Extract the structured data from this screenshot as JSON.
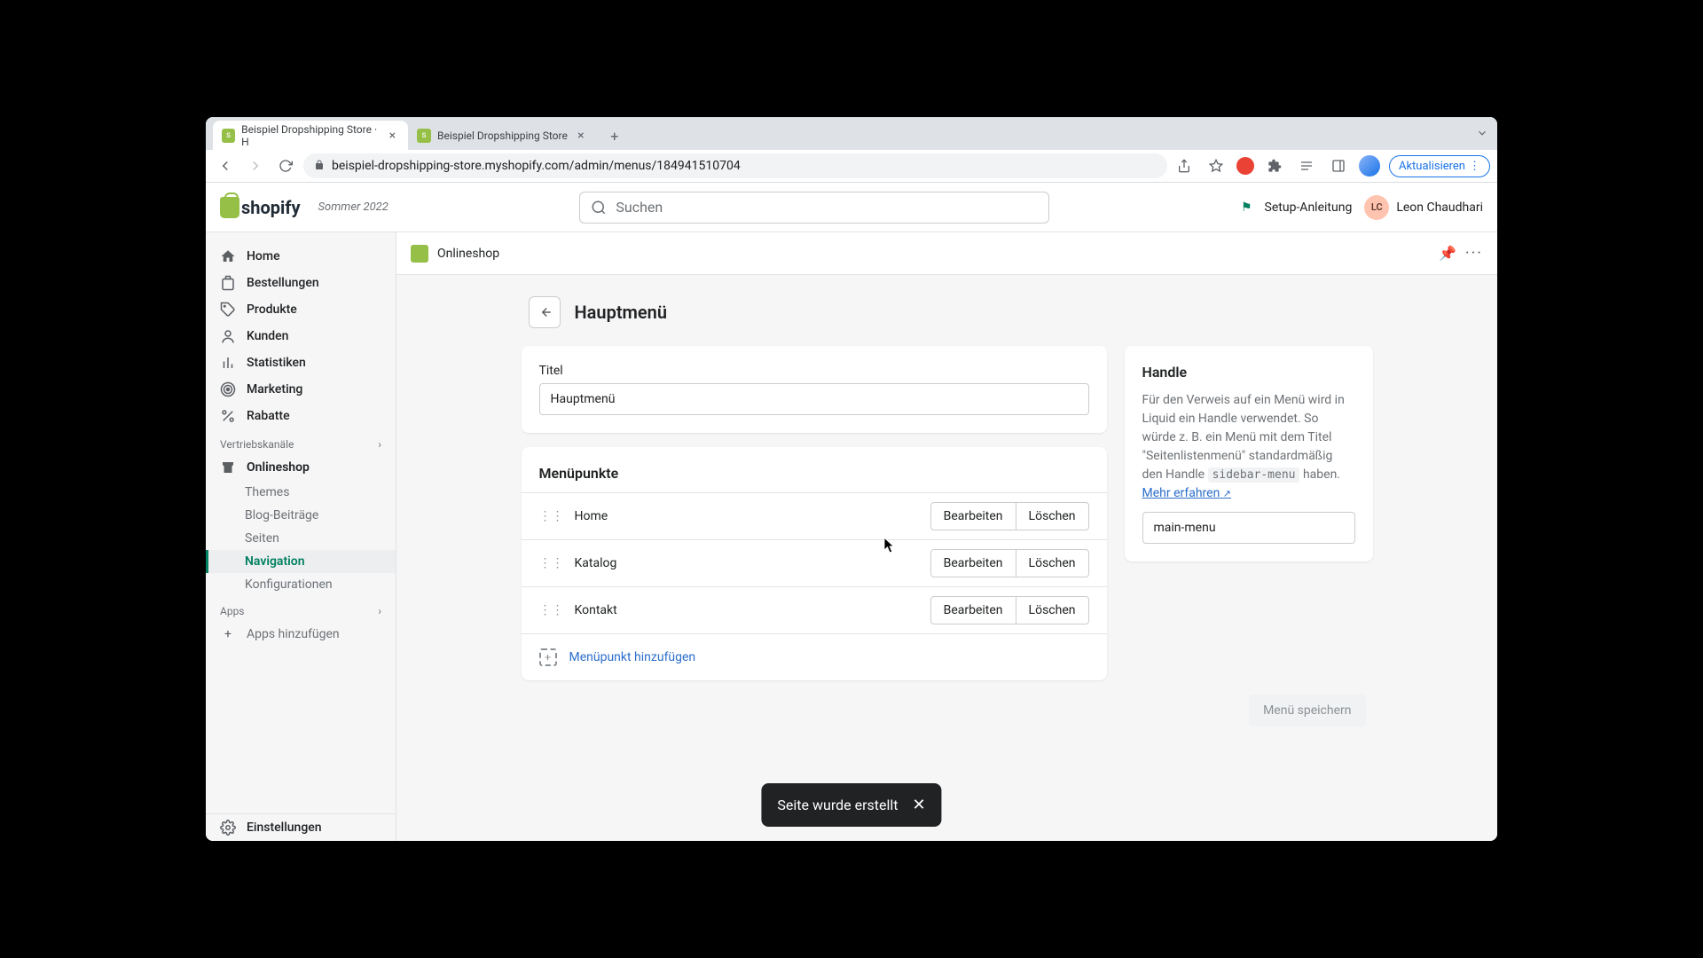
{
  "browser": {
    "tabs": [
      {
        "label": "Beispiel Dropshipping Store · H",
        "active": true
      },
      {
        "label": "Beispiel Dropshipping Store",
        "active": false
      }
    ],
    "url": "beispiel-dropshipping-store.myshopify.com/admin/menus/184941510704",
    "update_label": "Aktualisieren"
  },
  "header": {
    "brand": "shopify",
    "season": "Sommer 2022",
    "search_placeholder": "Suchen",
    "setup_label": "Setup-Anleitung",
    "user_initials": "LC",
    "user_name": "Leon Chaudhari"
  },
  "sidebar": {
    "items": [
      {
        "label": "Home"
      },
      {
        "label": "Bestellungen"
      },
      {
        "label": "Produkte"
      },
      {
        "label": "Kunden"
      },
      {
        "label": "Statistiken"
      },
      {
        "label": "Marketing"
      },
      {
        "label": "Rabatte"
      }
    ],
    "channels_label": "Vertriebskanäle",
    "onlineshop": "Onlineshop",
    "sub": [
      {
        "label": "Themes"
      },
      {
        "label": "Blog-Beiträge"
      },
      {
        "label": "Seiten"
      },
      {
        "label": "Navigation"
      },
      {
        "label": "Konfigurationen"
      }
    ],
    "apps_label": "Apps",
    "add_apps": "Apps hinzufügen",
    "settings": "Einstellungen"
  },
  "topbar": {
    "title": "Onlineshop"
  },
  "page": {
    "title": "Hauptmenü",
    "titel_label": "Titel",
    "titel_value": "Hauptmenü",
    "section_title": "Menüpunkte",
    "items": [
      {
        "label": "Home"
      },
      {
        "label": "Katalog"
      },
      {
        "label": "Kontakt"
      }
    ],
    "edit_label": "Bearbeiten",
    "delete_label": "Löschen",
    "add_item_label": "Menüpunkt hinzufügen",
    "save_label": "Menü speichern"
  },
  "handle": {
    "title": "Handle",
    "desc_pre": "Für den Verweis auf ein Menü wird in Liquid ein Handle verwendet. So würde z. B. ein Menü mit dem Titel \"Seitenlistenmenü\" standardmäßig den Handle ",
    "code": "sidebar-menu",
    "desc_post": " haben. ",
    "link_label": "Mehr erfahren",
    "value": "main-menu"
  },
  "toast": {
    "message": "Seite wurde erstellt"
  }
}
